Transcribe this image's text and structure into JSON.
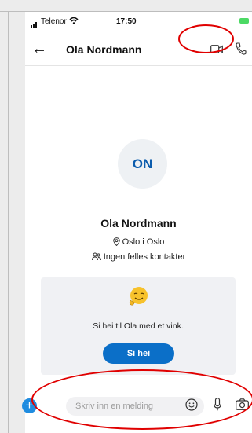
{
  "status_bar": {
    "carrier": "Telenor",
    "time": "17:50"
  },
  "header": {
    "title": "Ola Nordmann"
  },
  "profile": {
    "initials": "ON",
    "name": "Ola Nordmann",
    "location": "Oslo i Oslo",
    "contacts": "Ingen felles kontakter"
  },
  "card": {
    "text": "Si hei til Ola med et vink.",
    "button_label": "Si hei"
  },
  "composer": {
    "placeholder": "Skriv inn en melding"
  },
  "colors": {
    "accent": "#0b6fc8",
    "annotation_ring": "#e00000"
  }
}
